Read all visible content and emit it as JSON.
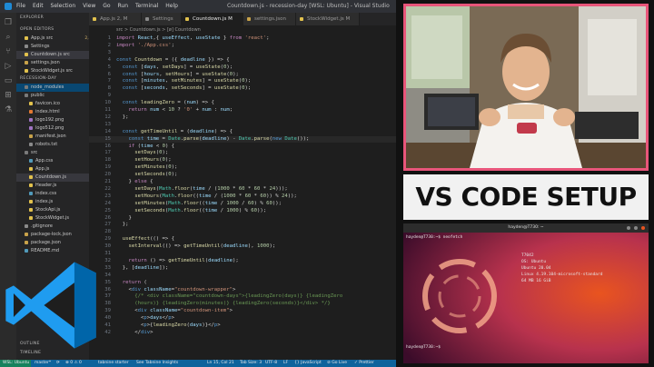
{
  "titlebar": {
    "menu": [
      "File",
      "Edit",
      "Selection",
      "View",
      "Go",
      "Run",
      "Terminal",
      "Help"
    ],
    "window_title": "Countdown.js - recession-day [WSL: Ubuntu] - Visual Studio Code"
  },
  "tabs": [
    {
      "label": "App.js 2, M",
      "color": "#e2c24d"
    },
    {
      "label": "Settings",
      "color": "#8a8a8a"
    },
    {
      "label": "Countdown.js M",
      "color": "#e2c24d"
    },
    {
      "label": "settings.json",
      "color": "#c8a24a"
    },
    {
      "label": "StockWidget.js M",
      "color": "#e2c24d"
    }
  ],
  "breadcrumb": "src > Countdown.js > [ø] Countdown",
  "sidebar": {
    "explorer_label": "EXPLORER",
    "open_editors_label": "OPEN EDITORS",
    "open_editors": [
      {
        "label": "App.js src",
        "badge": "2, M",
        "color": "#e2c24d"
      },
      {
        "label": "Settings",
        "badge": "",
        "color": "#8a8a8a"
      },
      {
        "label": "Countdown.js src",
        "badge": "M",
        "color": "#e2c24d"
      },
      {
        "label": "settings.json",
        "badge": "",
        "color": "#c8a24a"
      },
      {
        "label": "StockWidget.js src",
        "badge": "M",
        "color": "#e2c24d"
      }
    ],
    "project_label": "RECESSION-DAY",
    "tree": [
      {
        "label": "node_modules",
        "badge": "",
        "color": "#7a7a7a",
        "indent": 1
      },
      {
        "label": "public",
        "badge": "",
        "color": "#7a7a7a",
        "indent": 1
      },
      {
        "label": "favicon.ico",
        "badge": "",
        "color": "#e2c24d",
        "indent": 2
      },
      {
        "label": "index.html",
        "badge": "",
        "color": "#e37933",
        "indent": 2
      },
      {
        "label": "logo192.png",
        "badge": "",
        "color": "#a074c4",
        "indent": 2
      },
      {
        "label": "logo512.png",
        "badge": "",
        "color": "#a074c4",
        "indent": 2
      },
      {
        "label": "manifest.json",
        "badge": "",
        "color": "#c8a24a",
        "indent": 2
      },
      {
        "label": "robots.txt",
        "badge": "",
        "color": "#8a8a8a",
        "indent": 2
      },
      {
        "label": "src",
        "badge": "",
        "color": "#7a7a7a",
        "indent": 1
      },
      {
        "label": "App.css",
        "badge": "M",
        "color": "#519aba",
        "indent": 2
      },
      {
        "label": "App.js",
        "badge": "M",
        "color": "#e2c24d",
        "indent": 2
      },
      {
        "label": "Countdown.js",
        "badge": "M",
        "color": "#e2c24d",
        "indent": 2
      },
      {
        "label": "Header.js",
        "badge": "",
        "color": "#e2c24d",
        "indent": 2
      },
      {
        "label": "index.css",
        "badge": "",
        "color": "#519aba",
        "indent": 2
      },
      {
        "label": "index.js",
        "badge": "",
        "color": "#e2c24d",
        "indent": 2
      },
      {
        "label": "StockApi.js",
        "badge": "M",
        "color": "#e2c24d",
        "indent": 2
      },
      {
        "label": "StockWidget.js",
        "badge": "M",
        "color": "#e2c24d",
        "indent": 2
      },
      {
        "label": ".gitignore",
        "badge": "",
        "color": "#8a8a8a",
        "indent": 1
      },
      {
        "label": "package-lock.json",
        "badge": "",
        "color": "#c8a24a",
        "indent": 1
      },
      {
        "label": "package.json",
        "badge": "",
        "color": "#c8a24a",
        "indent": 1
      },
      {
        "label": "README.md",
        "badge": "",
        "color": "#519aba",
        "indent": 1
      }
    ],
    "outline_label": "OUTLINE",
    "timeline_label": "TIMELINE"
  },
  "code": [
    [
      [
        "kw",
        "import "
      ],
      [
        "vr",
        "React"
      ],
      [
        "",
        ","
      ],
      [
        "",
        "{ "
      ],
      [
        "vr",
        "useEffect"
      ],
      [
        "",
        ", "
      ],
      [
        "vr",
        "useState"
      ],
      [
        "",
        " } "
      ],
      [
        "kw",
        "from "
      ],
      [
        "st",
        "'react'"
      ],
      [
        "",
        ";"
      ]
    ],
    [
      [
        "kw",
        "import "
      ],
      [
        "st",
        "'./App.css'"
      ],
      [
        "",
        ";"
      ]
    ],
    [],
    [
      [
        "kw2",
        "const "
      ],
      [
        "fn",
        "Countdown"
      ],
      [
        "",
        " = ({ "
      ],
      [
        "vr",
        "deadline"
      ],
      [
        "",
        " }) => {"
      ]
    ],
    [
      [
        "",
        "  "
      ],
      [
        "kw2",
        "const "
      ],
      [
        "",
        "["
      ],
      [
        "vr",
        "days"
      ],
      [
        "",
        ", "
      ],
      [
        "fn",
        "setDays"
      ],
      [
        "",
        "] = "
      ],
      [
        "fn",
        "useState"
      ],
      [
        "",
        "("
      ],
      [
        "nm",
        "0"
      ],
      [
        "",
        ");"
      ]
    ],
    [
      [
        "",
        "  "
      ],
      [
        "kw2",
        "const "
      ],
      [
        "",
        "["
      ],
      [
        "vr",
        "hours"
      ],
      [
        "",
        ", "
      ],
      [
        "fn",
        "setHours"
      ],
      [
        "",
        "] = "
      ],
      [
        "fn",
        "useState"
      ],
      [
        "",
        "("
      ],
      [
        "nm",
        "0"
      ],
      [
        "",
        ");"
      ]
    ],
    [
      [
        "",
        "  "
      ],
      [
        "kw2",
        "const "
      ],
      [
        "",
        "["
      ],
      [
        "vr",
        "minutes"
      ],
      [
        "",
        ", "
      ],
      [
        "fn",
        "setMinutes"
      ],
      [
        "",
        "] = "
      ],
      [
        "fn",
        "useState"
      ],
      [
        "",
        "("
      ],
      [
        "nm",
        "0"
      ],
      [
        "",
        ");"
      ]
    ],
    [
      [
        "",
        "  "
      ],
      [
        "kw2",
        "const "
      ],
      [
        "",
        "["
      ],
      [
        "vr",
        "seconds"
      ],
      [
        "",
        ", "
      ],
      [
        "fn",
        "setSeconds"
      ],
      [
        "",
        "] = "
      ],
      [
        "fn",
        "useState"
      ],
      [
        "",
        "("
      ],
      [
        "nm",
        "0"
      ],
      [
        "",
        ");"
      ]
    ],
    [],
    [
      [
        "",
        "  "
      ],
      [
        "kw2",
        "const "
      ],
      [
        "fn",
        "leadingZero"
      ],
      [
        "",
        " = ("
      ],
      [
        "vr",
        "num"
      ],
      [
        "",
        ") => {"
      ]
    ],
    [
      [
        "",
        "    "
      ],
      [
        "kw",
        "return "
      ],
      [
        "vr",
        "num"
      ],
      [
        "",
        " < "
      ],
      [
        "nm",
        "10"
      ],
      [
        "",
        " ? "
      ],
      [
        "st",
        "'0'"
      ],
      [
        "",
        " + "
      ],
      [
        "vr",
        "num"
      ],
      [
        "",
        " : "
      ],
      [
        "vr",
        "num"
      ],
      [
        "",
        ";"
      ]
    ],
    [
      [
        "",
        "  };"
      ]
    ],
    [],
    [
      [
        "",
        "  "
      ],
      [
        "kw2",
        "const "
      ],
      [
        "fn",
        "getTimeUntil"
      ],
      [
        "",
        " = ("
      ],
      [
        "vr",
        "deadline"
      ],
      [
        "",
        ") => {"
      ]
    ],
    [
      [
        "",
        "    "
      ],
      [
        "kw2",
        "const "
      ],
      [
        "vr",
        "time"
      ],
      [
        "",
        " = "
      ],
      [
        "cls",
        "Date"
      ],
      [
        "",
        "."
      ],
      [
        "fn",
        "parse"
      ],
      [
        "",
        "("
      ],
      [
        "vr",
        "deadline"
      ],
      [
        "",
        ") - "
      ],
      [
        "cls",
        "Date"
      ],
      [
        "",
        "."
      ],
      [
        "fn",
        "parse"
      ],
      [
        "",
        "("
      ],
      [
        "kw2",
        "new "
      ],
      [
        "cls",
        "Date"
      ],
      [
        "",
        "());"
      ]
    ],
    [
      [
        "",
        "    "
      ],
      [
        "kw",
        "if "
      ],
      [
        "",
        "("
      ],
      [
        "vr",
        "time"
      ],
      [
        "",
        " < "
      ],
      [
        "nm",
        "0"
      ],
      [
        "",
        ") {"
      ]
    ],
    [
      [
        "",
        "      "
      ],
      [
        "fn",
        "setDays"
      ],
      [
        "",
        "("
      ],
      [
        "nm",
        "0"
      ],
      [
        "",
        ");"
      ]
    ],
    [
      [
        "",
        "      "
      ],
      [
        "fn",
        "setHours"
      ],
      [
        "",
        "("
      ],
      [
        "nm",
        "0"
      ],
      [
        "",
        ");"
      ]
    ],
    [
      [
        "",
        "      "
      ],
      [
        "fn",
        "setMinutes"
      ],
      [
        "",
        "("
      ],
      [
        "nm",
        "0"
      ],
      [
        "",
        ");"
      ]
    ],
    [
      [
        "",
        "      "
      ],
      [
        "fn",
        "setSeconds"
      ],
      [
        "",
        "("
      ],
      [
        "nm",
        "0"
      ],
      [
        "",
        ");"
      ]
    ],
    [
      [
        "",
        "    } "
      ],
      [
        "kw",
        "else "
      ],
      [
        "",
        "{"
      ]
    ],
    [
      [
        "",
        "      "
      ],
      [
        "fn",
        "setDays"
      ],
      [
        "",
        "("
      ],
      [
        "cls",
        "Math"
      ],
      [
        "",
        "."
      ],
      [
        "fn",
        "floor"
      ],
      [
        "",
        "("
      ],
      [
        "vr",
        "time"
      ],
      [
        "",
        " / ("
      ],
      [
        "nm",
        "1000"
      ],
      [
        "",
        " * "
      ],
      [
        "nm",
        "60"
      ],
      [
        "",
        " * "
      ],
      [
        "nm",
        "60"
      ],
      [
        "",
        " * "
      ],
      [
        "nm",
        "24"
      ],
      [
        "",
        ")));"
      ]
    ],
    [
      [
        "",
        "      "
      ],
      [
        "fn",
        "setHours"
      ],
      [
        "",
        "("
      ],
      [
        "cls",
        "Math"
      ],
      [
        "",
        "."
      ],
      [
        "fn",
        "floor"
      ],
      [
        "",
        "(("
      ],
      [
        "vr",
        "time"
      ],
      [
        "",
        " / ("
      ],
      [
        "nm",
        "1000"
      ],
      [
        "",
        " * "
      ],
      [
        "nm",
        "60"
      ],
      [
        "",
        " * "
      ],
      [
        "nm",
        "60"
      ],
      [
        "",
        ")) % "
      ],
      [
        "nm",
        "24"
      ],
      [
        "",
        "));"
      ]
    ],
    [
      [
        "",
        "      "
      ],
      [
        "fn",
        "setMinutes"
      ],
      [
        "",
        "("
      ],
      [
        "cls",
        "Math"
      ],
      [
        "",
        "."
      ],
      [
        "fn",
        "floor"
      ],
      [
        "",
        "(("
      ],
      [
        "vr",
        "time"
      ],
      [
        "",
        " / "
      ],
      [
        "nm",
        "1000"
      ],
      [
        "",
        " / "
      ],
      [
        "nm",
        "60"
      ],
      [
        "",
        ") % "
      ],
      [
        "nm",
        "60"
      ],
      [
        "",
        "));"
      ]
    ],
    [
      [
        "",
        "      "
      ],
      [
        "fn",
        "setSeconds"
      ],
      [
        "",
        "("
      ],
      [
        "cls",
        "Math"
      ],
      [
        "",
        "."
      ],
      [
        "fn",
        "floor"
      ],
      [
        "",
        "(("
      ],
      [
        "vr",
        "time"
      ],
      [
        "",
        " / "
      ],
      [
        "nm",
        "1000"
      ],
      [
        "",
        ") % "
      ],
      [
        "nm",
        "60"
      ],
      [
        "",
        "));"
      ]
    ],
    [
      [
        "",
        "    }"
      ]
    ],
    [
      [
        "",
        "  };"
      ]
    ],
    [],
    [
      [
        "",
        "  "
      ],
      [
        "fn",
        "useEffect"
      ],
      [
        "",
        "(() => {"
      ]
    ],
    [
      [
        "",
        "    "
      ],
      [
        "fn",
        "setInterval"
      ],
      [
        "",
        "(() => "
      ],
      [
        "fn",
        "getTimeUntil"
      ],
      [
        "",
        "("
      ],
      [
        "vr",
        "deadline"
      ],
      [
        "",
        "), "
      ],
      [
        "nm",
        "1000"
      ],
      [
        "",
        ");"
      ]
    ],
    [],
    [
      [
        "",
        "    "
      ],
      [
        "kw",
        "return "
      ],
      [
        "",
        "() => "
      ],
      [
        "fn",
        "getTimeUntil"
      ],
      [
        "",
        "("
      ],
      [
        "vr",
        "deadline"
      ],
      [
        "",
        ");"
      ]
    ],
    [
      [
        "",
        "  }, ["
      ],
      [
        "vr",
        "deadline"
      ],
      [
        "",
        "]);"
      ]
    ],
    [],
    [
      [
        "",
        "  "
      ],
      [
        "kw",
        "return "
      ],
      [
        "",
        "("
      ]
    ],
    [
      [
        "",
        "    <"
      ],
      [
        "tg",
        "div "
      ],
      [
        "at",
        "className"
      ],
      [
        "",
        "="
      ],
      [
        "st",
        "\"countdown-wrapper\""
      ],
      [
        "",
        ">"
      ]
    ],
    [
      [
        "",
        "      "
      ],
      [
        "cm",
        "{/* <div className=\"countdown-days\">{leadingZero(days)} {leadingZero"
      ]
    ],
    [
      [
        "",
        "      "
      ],
      [
        "cm",
        "(hours)} {leadingZero(minutes)} {leadingZero(seconds)}</div> */}"
      ]
    ],
    [
      [
        "",
        "      <"
      ],
      [
        "tg",
        "div "
      ],
      [
        "at",
        "className"
      ],
      [
        "",
        "="
      ],
      [
        "st",
        "\"countdown-item\""
      ],
      [
        "",
        ">"
      ]
    ],
    [
      [
        "",
        "        <"
      ],
      [
        "tg",
        "p"
      ],
      [
        "",
        ">"
      ],
      [
        "vr",
        "days"
      ],
      [
        "",
        "</"
      ],
      [
        "tg",
        "p"
      ],
      [
        "",
        ">"
      ]
    ],
    [
      [
        "",
        "        <"
      ],
      [
        "tg",
        "p"
      ],
      [
        "",
        ">{"
      ],
      [
        "fn",
        "leadingZero"
      ],
      [
        "",
        "("
      ],
      [
        "vr",
        "days"
      ],
      [
        "",
        ")}</"
      ],
      [
        "tg",
        "p"
      ],
      [
        "",
        ">"
      ]
    ],
    [
      [
        "",
        "      </"
      ],
      [
        "tg",
        "div"
      ],
      [
        "",
        ">"
      ]
    ]
  ],
  "statusbar": {
    "remote": "WSL: Ubuntu",
    "branch": "master*",
    "sync": "⟳",
    "errors": "⊗ 0 ⚠ 0",
    "tabnine": "tabnine starter",
    "tabnine2": "See Tabnine Insights",
    "position": "Ln 15, Col 21",
    "spaces": "Tab Size: 3",
    "encoding": "UTF-8",
    "eol": "LF",
    "language": "{} JavaScript",
    "golive": "⊘ Go Live",
    "prettier": "✓ Prettier"
  },
  "banner_text": "VS CODE SETUP",
  "terminal": {
    "title": "hayden@T730: ~",
    "prompt_top": "hayden@T730:~$ neofetch",
    "prompt_bottom": "hayden@T730:~$",
    "info": [
      "T7042",
      "OS: Ubuntu",
      "Ubuntu 20.04",
      "Linux 4.19.104-microsoft-standard",
      "64 MB 16 GiB"
    ]
  },
  "colors": {
    "accent_pink": "#e8557a",
    "vscode_blue": "#0e639c",
    "banner_bg": "#f1f1f1"
  }
}
